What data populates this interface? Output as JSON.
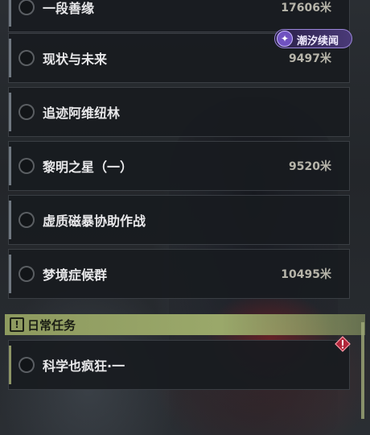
{
  "quests": [
    {
      "title": "一段善缘",
      "distance": "17606米"
    },
    {
      "title": "现状与未来",
      "distance": "9497米"
    },
    {
      "title": "追迹阿维纽林",
      "distance": ""
    },
    {
      "title": "黎明之星（一）",
      "distance": "9520米"
    },
    {
      "title": "虚质磁暴协助作战",
      "distance": ""
    },
    {
      "title": "梦境症候群",
      "distance": "10495米"
    }
  ],
  "daily_section": {
    "label": "日常任务",
    "icon": "exclamation-icon"
  },
  "daily_quests": [
    {
      "title": "科学也疯狂·一"
    }
  ],
  "badge": {
    "label": "潮汐续闻",
    "icon": "tide-logo-icon"
  },
  "colors": {
    "section_accent": "#9aa86a",
    "badge_purple": "#7052c0",
    "warning_red": "#b0263a"
  }
}
